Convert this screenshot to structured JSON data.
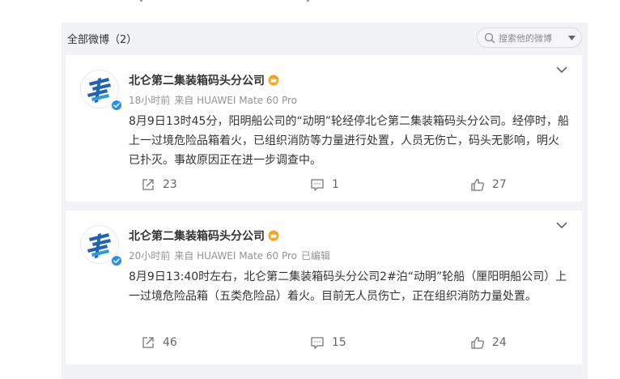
{
  "filter": {
    "title": "全部微博（2）",
    "search_placeholder": "搜索他的微博"
  },
  "posts": [
    {
      "user_name": "北仑第二集装箱码头分公司",
      "time": "18小时前",
      "source": "来自 HUAWEI Mate 60 Pro",
      "edited": "",
      "text": "8月9日13时45分，阳明船公司的“动明”轮经停北仑第二集装箱码头分公司。经停时，船上一过境危险品箱着火，已组织消防等力量进行处置，人员无伤亡，码头无影响，明火已扑灭。事故原因正在进一步调查中。",
      "shares": "23",
      "comments": "1",
      "likes": "27"
    },
    {
      "user_name": "北仑第二集装箱码头分公司",
      "time": "20小时前",
      "source": "来自 HUAWEI Mate 60 Pro",
      "edited": "已编辑",
      "text": "8月9日13:40时左右，北仑第二集装箱码头分公司2#泊“动明”轮船（厘阳明船公司）上一过境危险品箱（五类危险品）着火。目前无人员伤亡，正在组织消防力量处置。",
      "shares": "46",
      "comments": "15",
      "likes": "24"
    }
  ],
  "colors": {
    "page_bg": "#f1f2f5",
    "card_bg": "#ffffff",
    "logo_blue": "#1f63b5",
    "verify_blue": "#2d8cf0",
    "crown_gold": "#f4a623",
    "meta_gray": "#939393"
  },
  "icons": {
    "search": "search-icon",
    "share": "share-icon",
    "comment": "comment-icon",
    "like": "like-icon",
    "expand": "chevron-down-icon",
    "crown": "crown-icon"
  }
}
